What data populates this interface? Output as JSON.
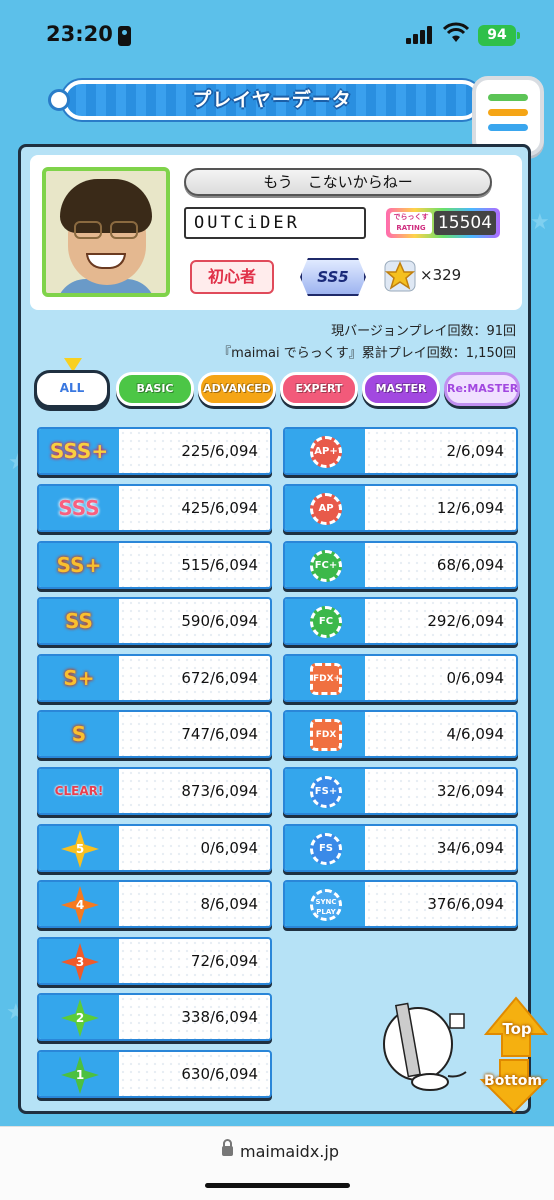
{
  "status_bar": {
    "time": "23:20",
    "battery": "94"
  },
  "header": {
    "title": "プレイヤーデータ"
  },
  "profile": {
    "name": "もう　こないからねー",
    "title_plate": "OUTCiDER",
    "rating_label": "でらっくす RATING",
    "rating": "15504",
    "class": "初心者",
    "course": "SS5",
    "stars": "×329"
  },
  "info": {
    "version_plays": "現バージョンプレイ回数：91回",
    "total_plays": "『maimai でらっくす』累計プレイ回数：1,150回"
  },
  "tabs": [
    {
      "label": "ALL",
      "color": "#ffffff"
    },
    {
      "label": "BASIC",
      "color": "#4cc646"
    },
    {
      "label": "ADVANCED",
      "color": "#f5a516"
    },
    {
      "label": "EXPERT",
      "color": "#f25a7a"
    },
    {
      "label": "MASTER",
      "color": "#a248e0"
    },
    {
      "label": "Re:MASTER",
      "color": "#e8c8ff"
    }
  ],
  "rank_counts": [
    {
      "icon": "sss-plus-rank-icon",
      "label": "SSS+",
      "count": "225/6,094"
    },
    {
      "icon": "sss-rank-icon",
      "label": "SSS",
      "count": "425/6,094"
    },
    {
      "icon": "ss-plus-rank-icon",
      "label": "SS+",
      "count": "515/6,094"
    },
    {
      "icon": "ss-rank-icon",
      "label": "SS",
      "count": "590/6,094"
    },
    {
      "icon": "s-plus-rank-icon",
      "label": "S+",
      "count": "672/6,094"
    },
    {
      "icon": "s-rank-icon",
      "label": "S",
      "count": "747/6,094"
    },
    {
      "icon": "clear-icon",
      "label": "CLEAR!",
      "count": "873/6,094"
    },
    {
      "icon": "dx-star-5-icon",
      "label": "5",
      "count": "0/6,094",
      "color": "#f8c020"
    },
    {
      "icon": "dx-star-4-icon",
      "label": "4",
      "count": "8/6,094",
      "color": "#f57a20"
    },
    {
      "icon": "dx-star-3-icon",
      "label": "3",
      "count": "72/6,094",
      "color": "#f05a2a"
    },
    {
      "icon": "dx-star-2-icon",
      "label": "2",
      "count": "338/6,094",
      "color": "#5ccc3a"
    },
    {
      "icon": "dx-star-1-icon",
      "label": "1",
      "count": "630/6,094",
      "color": "#4cc040"
    }
  ],
  "combo_counts": [
    {
      "icon": "ap-plus-icon",
      "label": "AP+",
      "count": "2/6,094",
      "color": "#e85a4a"
    },
    {
      "icon": "ap-icon",
      "label": "AP",
      "count": "12/6,094",
      "color": "#e85a4a"
    },
    {
      "icon": "fc-plus-icon",
      "label": "FC+",
      "count": "68/6,094",
      "color": "#3cb84a"
    },
    {
      "icon": "fc-icon",
      "label": "FC",
      "count": "292/6,094",
      "color": "#3cb84a"
    },
    {
      "icon": "fdx-plus-icon",
      "label": "FDX+",
      "count": "0/6,094",
      "color": "#f07040"
    },
    {
      "icon": "fdx-icon",
      "label": "FDX",
      "count": "4/6,094",
      "color": "#f07040"
    },
    {
      "icon": "fs-plus-icon",
      "label": "FS+",
      "count": "32/6,094",
      "color": "#3a8ae8"
    },
    {
      "icon": "fs-icon",
      "label": "FS",
      "count": "34/6,094",
      "color": "#3a8ae8"
    },
    {
      "icon": "sync-play-icon",
      "label": "SYNC PLAY",
      "count": "376/6,094",
      "color": "#4aa8f0"
    }
  ],
  "nav": {
    "top": "Top",
    "bottom": "Bottom"
  },
  "browser": {
    "url": "maimaidx.jp"
  }
}
